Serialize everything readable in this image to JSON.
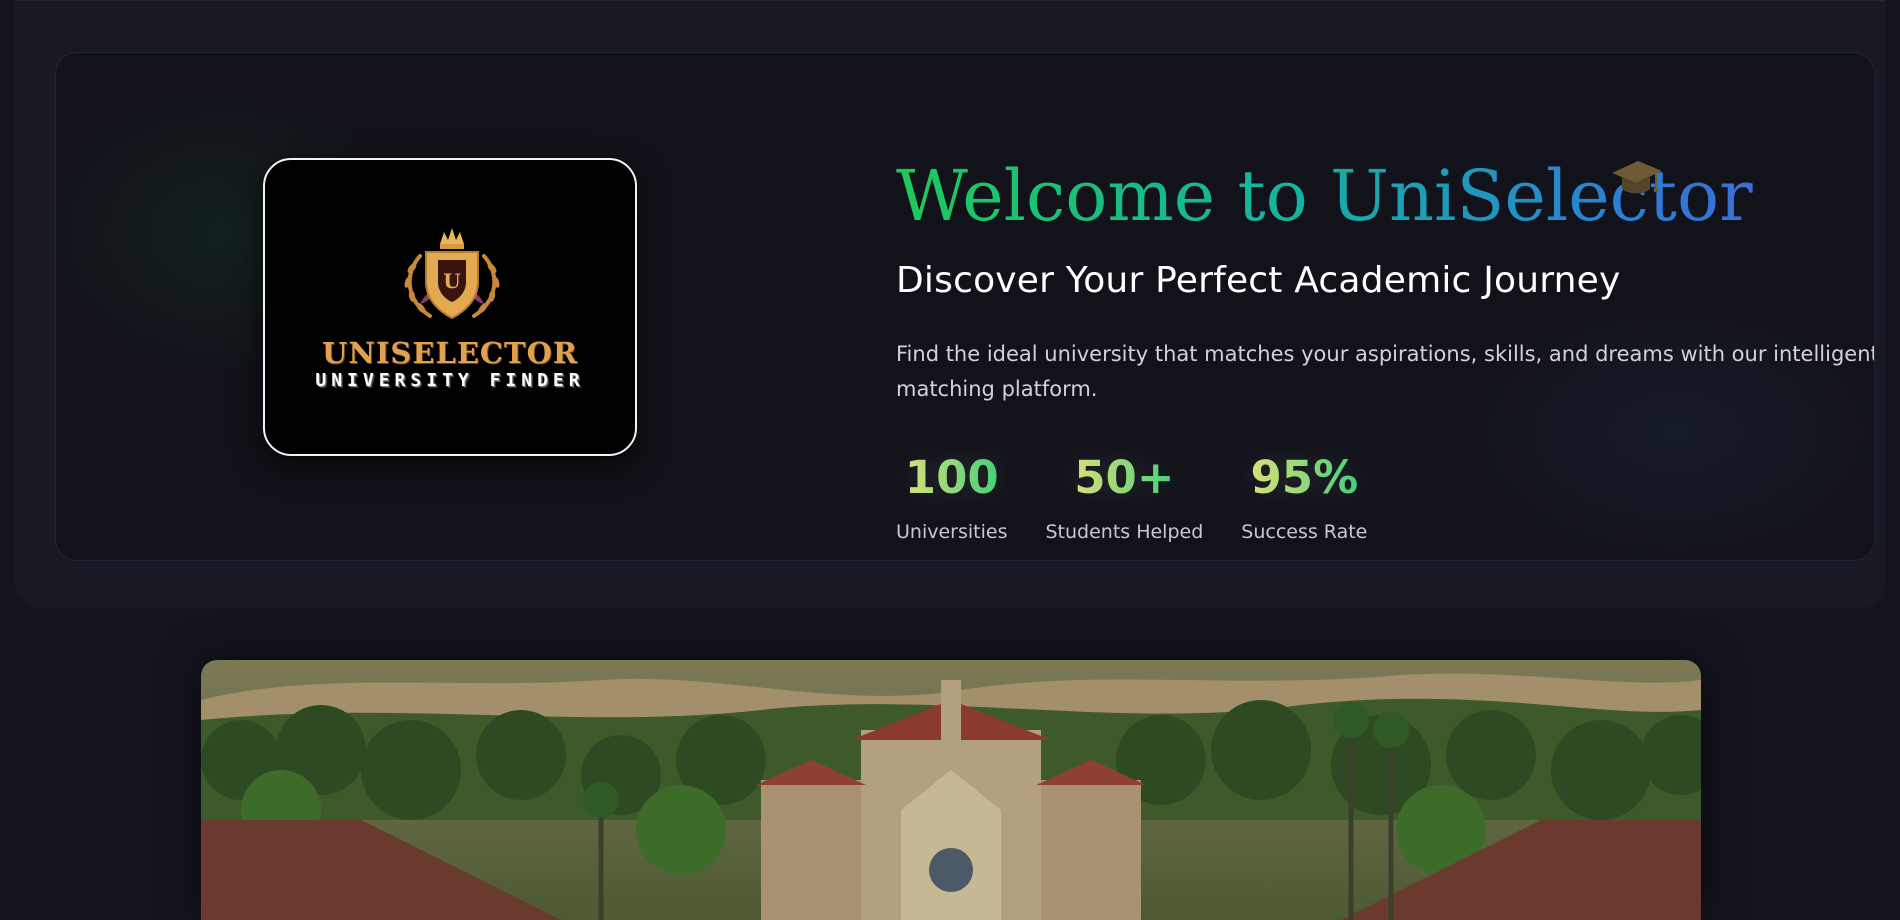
{
  "hero": {
    "logo": {
      "brand_name": "UNISELECTOR",
      "tagline": "UNIVERSITY FINDER",
      "emblem_letter": "U"
    },
    "title": "Welcome to UniSelector",
    "title_icon": "graduation-cap-icon",
    "subtitle": "Discover Your Perfect Academic Journey",
    "description": "Find the ideal university that matches your aspirations, skills, and dreams with our intelligent matching platform.",
    "stats": [
      {
        "value": "100",
        "label": "Universities"
      },
      {
        "value": "50+",
        "label": "Students Helped"
      },
      {
        "value": "95%",
        "label": "Success Rate"
      }
    ]
  },
  "colors": {
    "background": "#14141f",
    "card": "#12121a",
    "title_gradient_start": "#1ec95a",
    "title_gradient_end": "#3a6fd4",
    "stat_gradient_start": "#d9e07a",
    "stat_gradient_end": "#45d07a",
    "logo_gold": "#e0a24e"
  },
  "campus_image": {
    "subject": "university-campus-photo"
  }
}
